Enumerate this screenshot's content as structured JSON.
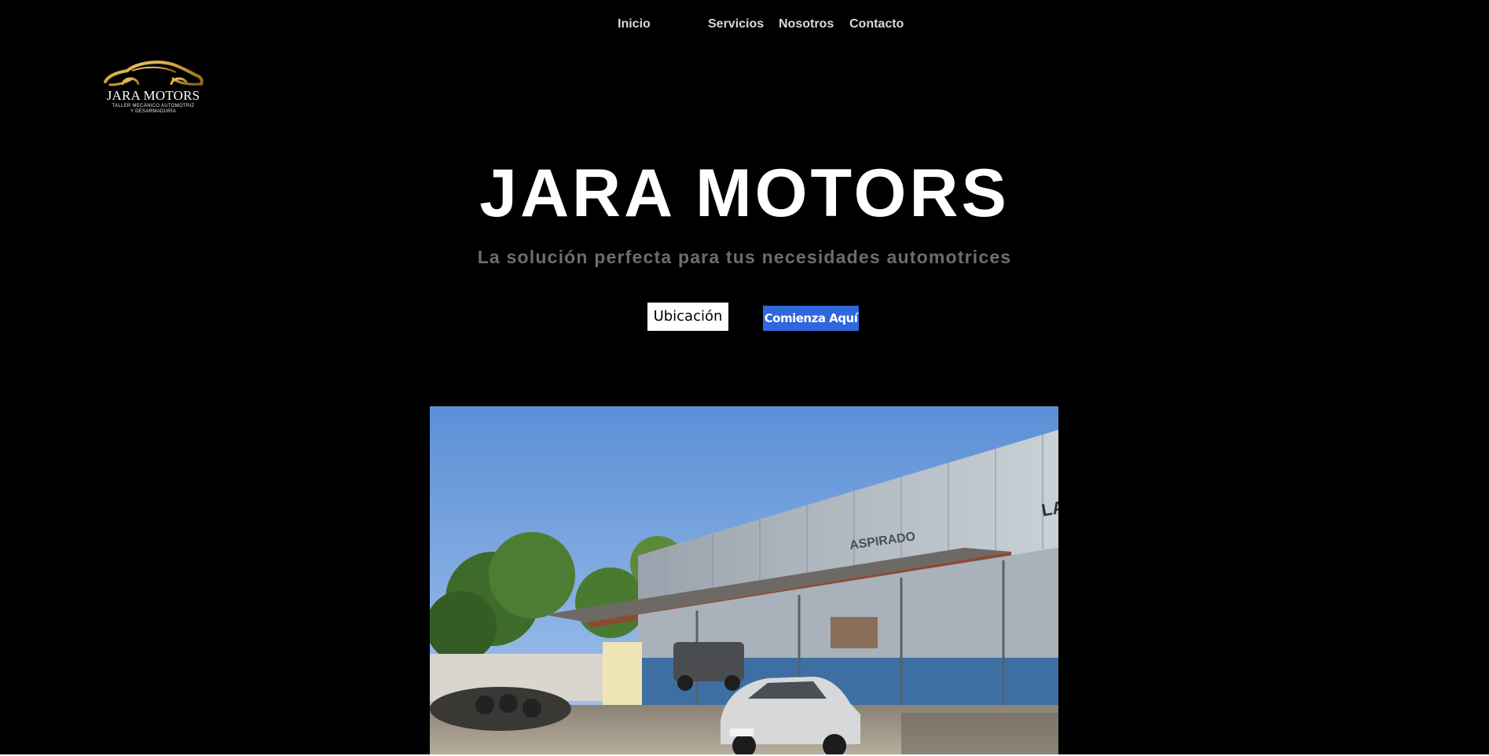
{
  "nav": {
    "items": [
      {
        "label": "Inicio"
      },
      {
        "label": "Servicios"
      },
      {
        "label": "Nosotros"
      },
      {
        "label": "Contacto"
      }
    ]
  },
  "logo": {
    "name": "JARA MOTORS",
    "tagline_line1": "TALLER MECÁNICO AUTOMOTRIZ",
    "tagline_line2": "Y DESARMADURÍA",
    "icon": "car-silhouette-icon",
    "accent_color": "#d4a53a"
  },
  "hero": {
    "title": "JARA MOTORS",
    "subtitle": "La solución perfecta para tus necesidades automotrices"
  },
  "buttons": {
    "location_label": "Ubicación",
    "start_label": "Comienza Aquí",
    "start_color": "#2f67dd"
  },
  "photo": {
    "signage_text": "ASPIRADO",
    "signage_text_2": "LA"
  }
}
